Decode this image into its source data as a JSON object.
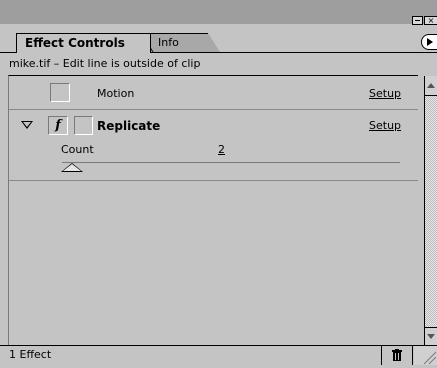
{
  "window": {
    "minimize_icon": "minimize-box-icon",
    "close_icon": "close-box-icon"
  },
  "tabs": [
    {
      "label": "Effect Controls",
      "active": true
    },
    {
      "label": "Info",
      "active": false
    }
  ],
  "panel_menu_icon": "panel-menu-arrow-icon",
  "clip_info": "mike.tif – Edit line is outside of clip",
  "effects": {
    "motion": {
      "label": "Motion",
      "setup_label": "Setup",
      "enabled": false
    },
    "replicate": {
      "label": "Replicate",
      "setup_label": "Setup",
      "expanded": true,
      "fx_glyph": "f",
      "param": {
        "label": "Count",
        "value": "2",
        "slider_position": 0.0
      }
    }
  },
  "footer": {
    "status": "1 Effect",
    "trash_icon": "trash-icon",
    "resize_icon": "resize-grip-icon"
  },
  "colors": {
    "panel_bg": "#c4c4c4",
    "titlebar_bg": "#9e9e9e",
    "inactive_tab": "#a8a8a8"
  }
}
